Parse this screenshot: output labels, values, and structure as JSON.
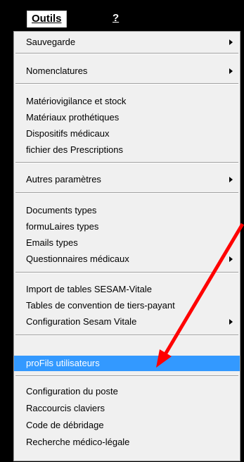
{
  "menubar": {
    "outils_label": "Outils",
    "help_label": "?"
  },
  "menu": {
    "items": [
      {
        "label": "Sauvegarde",
        "submenu": true
      },
      {
        "label": "Nomenclatures",
        "submenu": true
      },
      {
        "label": "Matériovigilance et stock",
        "submenu": false
      },
      {
        "label": "Matériaux prothétiques",
        "submenu": false
      },
      {
        "label": "Dispositifs médicaux",
        "submenu": false
      },
      {
        "label": "fichier des Prescriptions",
        "submenu": false
      },
      {
        "label": "Autres paramètres",
        "submenu": true
      },
      {
        "label": "Documents types",
        "submenu": false
      },
      {
        "label": "formuLaires types",
        "submenu": false
      },
      {
        "label": "Emails types",
        "submenu": false
      },
      {
        "label": "Questionnaires médicaux",
        "submenu": true
      },
      {
        "label": "Import de tables SESAM-Vitale",
        "submenu": false
      },
      {
        "label": "Tables de convention de tiers-payant",
        "submenu": false
      },
      {
        "label": "Configuration Sesam Vitale",
        "submenu": true
      },
      {
        "label": "proFils utilisateurs",
        "submenu": false,
        "selected": true
      },
      {
        "label": "Configuration du poste",
        "submenu": false
      },
      {
        "label": "Raccourcis claviers",
        "submenu": false
      },
      {
        "label": "Code de débridage",
        "submenu": false
      },
      {
        "label": "Recherche médico-légale",
        "submenu": false
      }
    ]
  },
  "colors": {
    "selection": "#3399ff",
    "annotation_arrow": "#ff0000"
  }
}
